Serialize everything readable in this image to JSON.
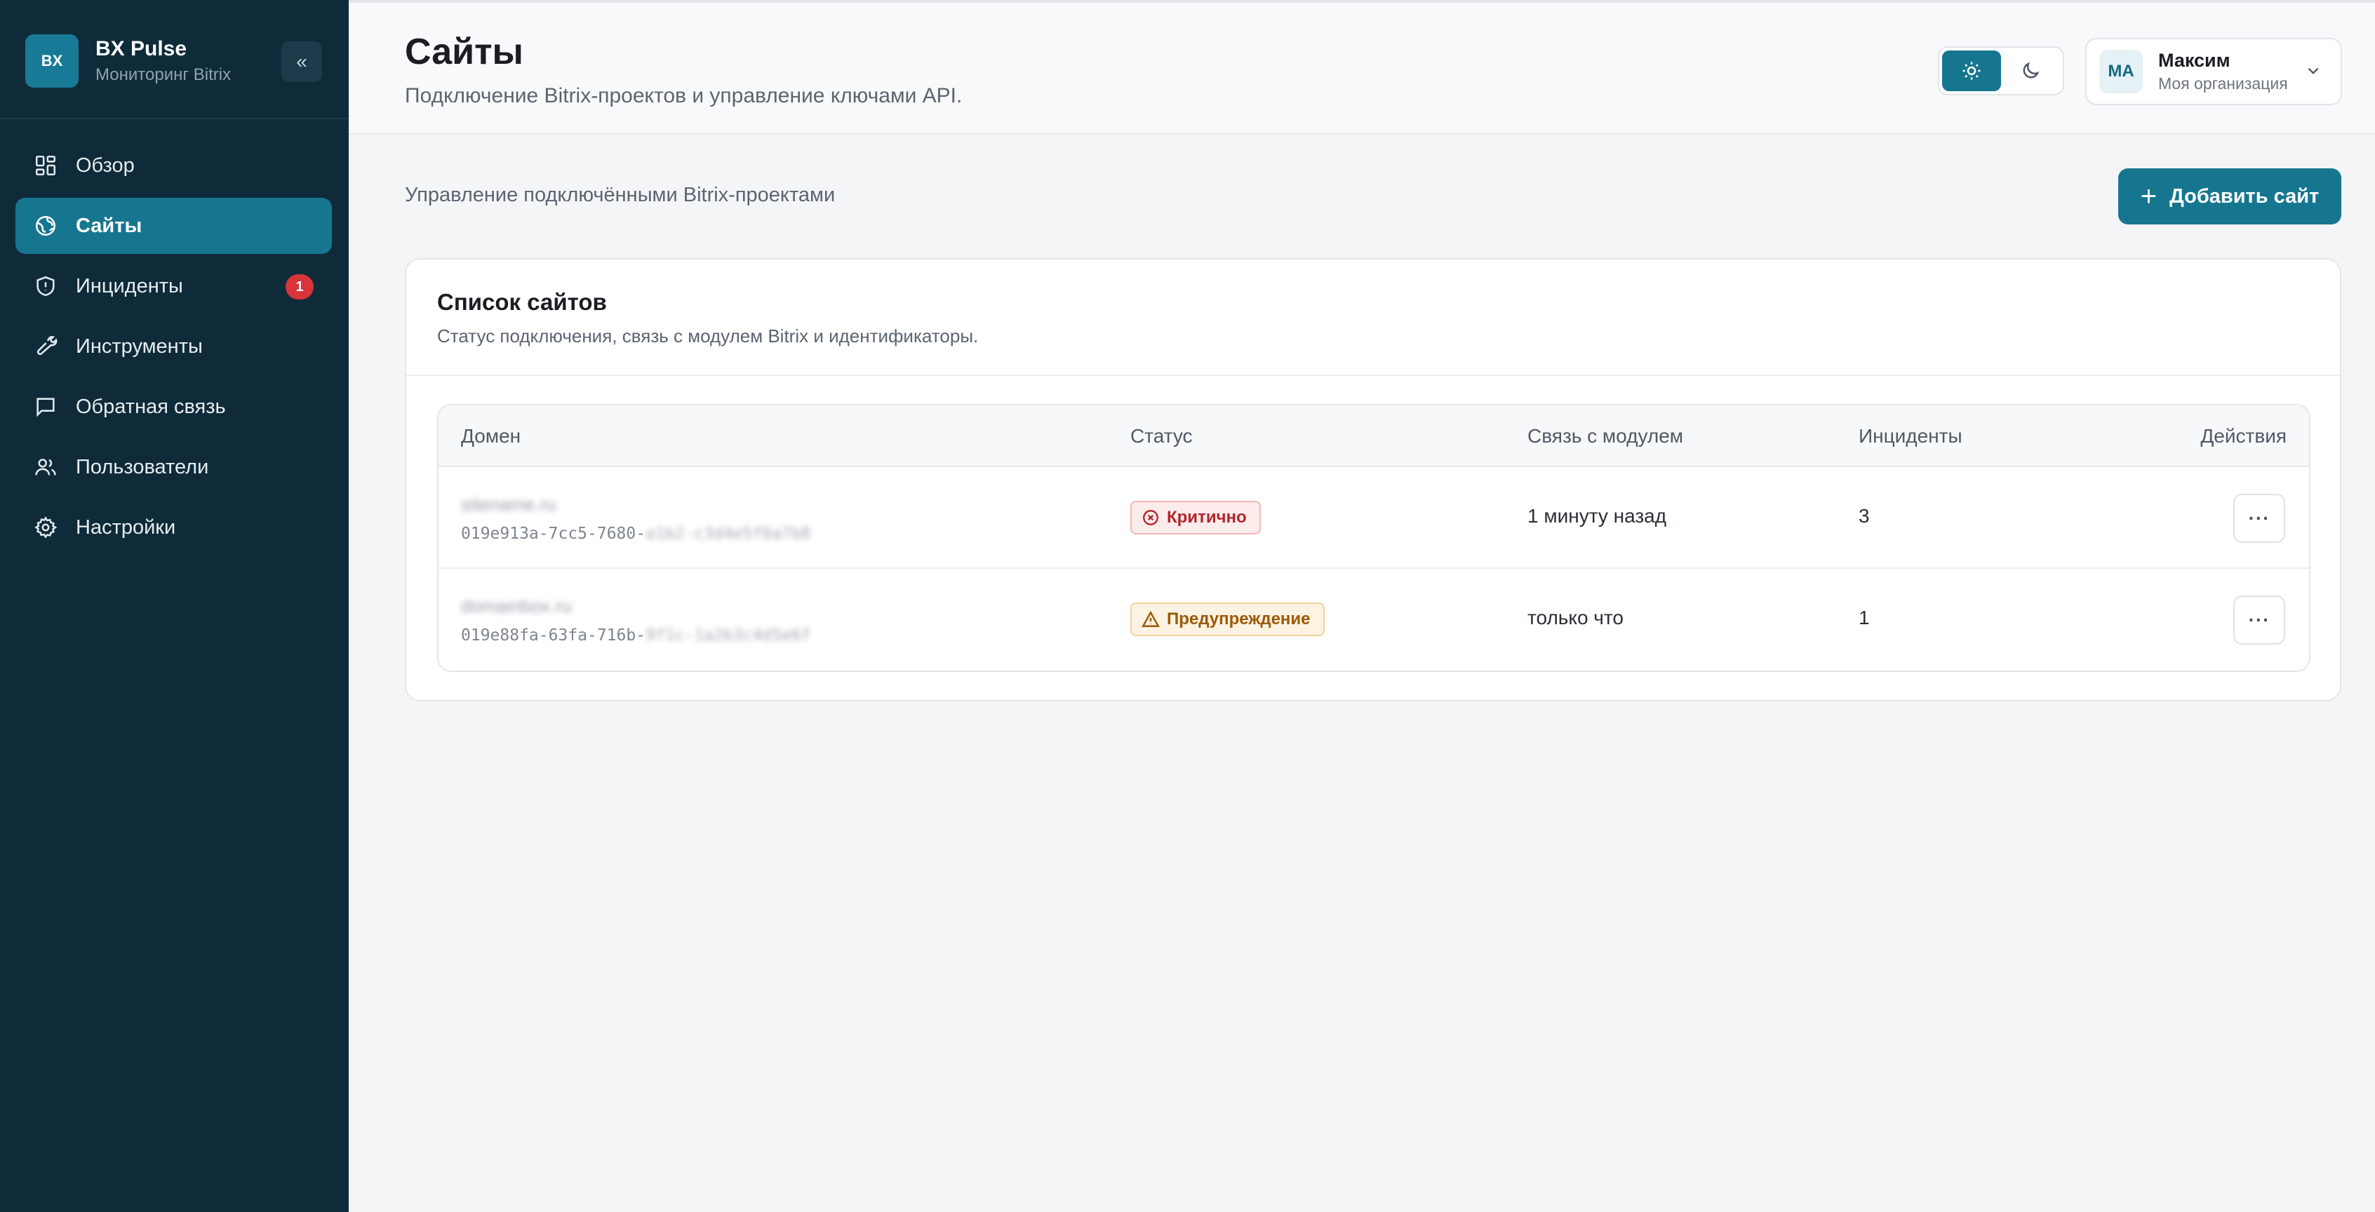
{
  "sidebar": {
    "brand_logo": "BX",
    "brand_name": "BX Pulse",
    "brand_sub": "Мониторинг Bitrix",
    "collapse_label": "«",
    "items": [
      {
        "label": "Обзор",
        "icon": "dashboard-icon"
      },
      {
        "label": "Сайты",
        "icon": "globe-icon",
        "active": true
      },
      {
        "label": "Инциденты",
        "icon": "shield-icon",
        "badge": "1"
      },
      {
        "label": "Инструменты",
        "icon": "wrench-icon"
      },
      {
        "label": "Обратная связь",
        "icon": "message-icon"
      },
      {
        "label": "Пользователи",
        "icon": "users-icon"
      },
      {
        "label": "Настройки",
        "icon": "gear-icon"
      }
    ]
  },
  "header": {
    "title": "Сайты",
    "subtitle": "Подключение Bitrix-проектов и управление ключами API.",
    "user": {
      "initials": "MA",
      "name": "Максим",
      "org": "Моя организация"
    }
  },
  "main": {
    "subtitle": "Управление подключёнными Bitrix-проектами",
    "add_button": "Добавить сайт",
    "add_button_icon": "+",
    "card": {
      "title": "Список сайтов",
      "subtitle": "Статус подключения, связь с модулем Bitrix и идентификаторы."
    },
    "table": {
      "columns": [
        "Домен",
        "Статус",
        "Связь с модулем",
        "Инциденты",
        "Действия"
      ],
      "rows": [
        {
          "domain": "sitename.ru",
          "id_prefix": "019e913a-7cc5-7680-",
          "id_masked": "a1b2-c3d4e5f6a7b8",
          "status": "Критично",
          "status_type": "critical",
          "module_link": "1 минуту назад",
          "incidents": "3",
          "action": "···"
        },
        {
          "domain": "domainbox.ru",
          "id_prefix": "019e88fa-63fa-716b-",
          "id_masked": "9f1c-1a2b3c4d5e6f",
          "status": "Предупреждение",
          "status_type": "warning",
          "module_link": "только что",
          "incidents": "1",
          "action": "···"
        }
      ]
    }
  },
  "colors": {
    "accent": "#167690",
    "sidebar_bg": "#0f2b3a",
    "critical": "#b3262b",
    "warning": "#9a5a06",
    "badge_red": "#d8343a"
  }
}
